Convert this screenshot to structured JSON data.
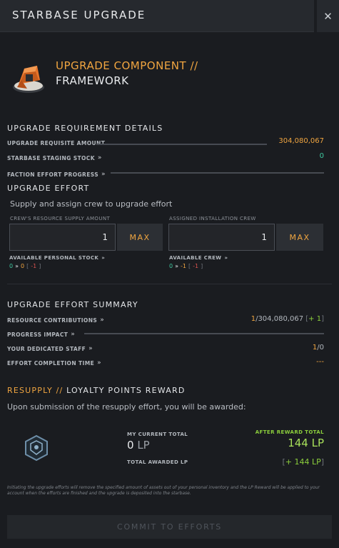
{
  "window": {
    "title": "STARBASE UPGRADE",
    "close_icon": "close-icon"
  },
  "component": {
    "line1": "UPGRADE COMPONENT //",
    "line2": "FRAMEWORK",
    "icon": "framework-component-icon"
  },
  "requirements": {
    "title": "UPGRADE REQUIREMENT DETAILS",
    "requisite_label": "UPGRADE REQUISITE AMOUNT",
    "requisite_value": "304,080,067",
    "staging_label": "STARBASE STAGING STOCK",
    "staging_value": "0",
    "faction_label": "FACTION EFFORT PROGRESS",
    "faction_progress": 0
  },
  "effort": {
    "title": "UPGRADE EFFORT",
    "hint": "Supply and assign crew to upgrade effort",
    "supply_label": "CREW'S RESOURCE SUPPLY AMOUNT",
    "supply_value": "1",
    "supply_max": "MAX",
    "crew_label": "ASSIGNED INSTALLATION CREW",
    "crew_value": "1",
    "crew_max": "MAX",
    "personal_stock_label": "AVAILABLE PERSONAL STOCK",
    "personal_stock_from": "0",
    "personal_stock_to": "0",
    "personal_stock_delta": "-1",
    "available_crew_label": "AVAILABLE CREW",
    "available_crew_from": "0",
    "available_crew_to": "-1",
    "available_crew_delta": "-1"
  },
  "summary": {
    "title": "UPGRADE EFFORT SUMMARY",
    "contrib_label": "RESOURCE CONTRIBUTIONS",
    "contrib_current": "1",
    "contrib_total": "/304,080,067",
    "contrib_delta": "+ 1",
    "impact_label": "PROGRESS IMPACT",
    "impact_progress": 0,
    "staff_label": "YOUR DEDICATED STAFF",
    "staff_current": "1",
    "staff_total": "/0",
    "time_label": "EFFORT COMPLETION TIME",
    "time_value": "---"
  },
  "reward": {
    "title_prefix": "RESUPPLY //",
    "title_suffix": "LOYALTY POINTS REWARD",
    "hint": "Upon submission of the resupply effort, you will be awarded:",
    "icon": "loyalty-shield-icon",
    "current_label": "MY CURRENT TOTAL",
    "current_value": "0",
    "current_unit": "LP",
    "total_awarded_label": "TOTAL AWARDED LP",
    "after_label": "AFTER REWARD TOTAL",
    "after_value": "144 LP",
    "awarded_value": "+ 144 LP",
    "disclaimer": "Initiating the upgrade efforts will remove the specified amount of assets out of your personal inventory and the LP Reward will be applied to your account when the efforts are finished and the upgrade is deposited into the starbase."
  },
  "commit": {
    "label": "COMMIT TO EFFORTS"
  },
  "colors": {
    "accent": "#f0a540",
    "positive": "#3fc9a0",
    "reward": "#a8e05a",
    "negative": "#d9534f"
  }
}
